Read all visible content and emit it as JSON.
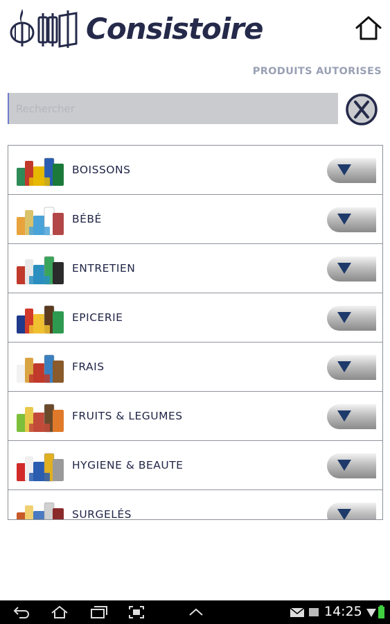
{
  "header": {
    "logo_text": "Consistoire",
    "home_icon": "home-icon",
    "section_title": "PRODUITS AUTORISES"
  },
  "search": {
    "placeholder": "Rechercher",
    "value": "",
    "clear_icon": "close-icon"
  },
  "categories": [
    {
      "label": "BOISSONS",
      "icon": "drinks-thumbnail"
    },
    {
      "label": "BÉBÉ",
      "icon": "baby-thumbnail"
    },
    {
      "label": "ENTRETIEN",
      "icon": "cleaning-thumbnail"
    },
    {
      "label": "EPICERIE",
      "icon": "grocery-thumbnail"
    },
    {
      "label": "FRAIS",
      "icon": "fresh-thumbnail"
    },
    {
      "label": "FRUITS & LEGUMES",
      "icon": "produce-thumbnail"
    },
    {
      "label": "HYGIENE & BEAUTE",
      "icon": "hygiene-thumbnail"
    },
    {
      "label": "SURGELÉS",
      "icon": "frozen-thumbnail"
    }
  ],
  "status_bar": {
    "time": "14:25",
    "icons": [
      "back-icon",
      "home-icon",
      "recent-apps-icon",
      "screenshot-icon",
      "menu-up-icon",
      "mail-icon",
      "notification-icon",
      "wifi-icon",
      "battery-icon"
    ]
  },
  "colors": {
    "brand": "#252a4a",
    "accent": "#1e3a6a",
    "subtitle": "#9aa1b4",
    "search_bg": "#c9cbce"
  }
}
